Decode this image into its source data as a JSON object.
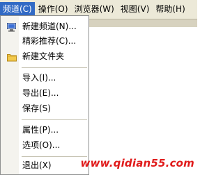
{
  "menubar": {
    "items": [
      {
        "label": "频道(C)"
      },
      {
        "label": "操作(O)"
      },
      {
        "label": "浏览器(W)"
      },
      {
        "label": "视图(V)"
      },
      {
        "label": "帮助(H)"
      }
    ]
  },
  "dropdown": {
    "groups": [
      {
        "items": [
          {
            "label": "新建频道(N)...",
            "icon": "new-channel-icon"
          },
          {
            "label": "精彩推荐(C)...",
            "icon": ""
          },
          {
            "label": "新建文件夹",
            "icon": "folder-icon"
          }
        ]
      },
      {
        "items": [
          {
            "label": "导入(I)..."
          },
          {
            "label": "导出(E)..."
          },
          {
            "label": "保存(S)"
          }
        ]
      },
      {
        "items": [
          {
            "label": "属性(P)..."
          },
          {
            "label": "选项(O)..."
          }
        ]
      },
      {
        "items": [
          {
            "label": "退出(X)"
          }
        ]
      }
    ]
  },
  "watermark": {
    "text": "www.qidian55.com"
  },
  "colors": {
    "menu_highlight": "#316ac5",
    "menubar_bg": "#ece9d8",
    "watermark": "#e01b1b",
    "folder": "#f2c94c"
  }
}
